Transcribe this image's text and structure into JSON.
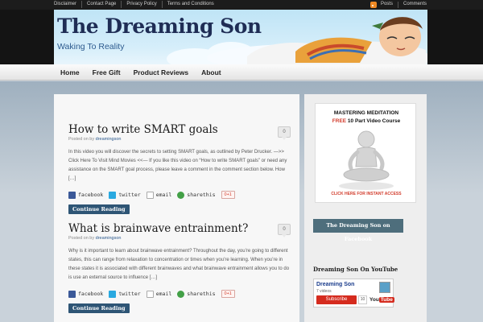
{
  "top_links": [
    "Disclaimer",
    "Contact Page",
    "Privacy Policy",
    "Terms and Conditions"
  ],
  "top_right": {
    "posts": "Posts",
    "comments": "Comments"
  },
  "site": {
    "title": "The Dreaming Son",
    "tagline": "Waking To Reality"
  },
  "nav": [
    "Home",
    "Free Gift",
    "Product Reviews",
    "About"
  ],
  "posts": [
    {
      "title": "How to write SMART goals",
      "posted_on_by": "Posted on by",
      "author": "dreamingson",
      "comments": "0",
      "excerpt": "In this video you will discover the secrets to setting SMART goals, as outlined by Peter Drucker. —>> Click Here To Visit Mind Movies <<— If you like this video on “How to write SMART goals” or need any assistance on the SMART goal process, please leave a comment in the comment section below. How […]",
      "continue": "Continue Reading"
    },
    {
      "title": "What is brainwave entrainment?",
      "posted_on_by": "Posted on by",
      "author": "dreamingson",
      "comments": "0",
      "excerpt": "Why is it important to learn about brainwave entrainment? Throughout the day, you’re going to different states, this can range from relaxation to concentration or times when you’re learning. When you’re in these states it is associated with different brainwaves and what brainwave entrainment allows you to do is use an external source to influence […]",
      "continue": "Continue Reading"
    }
  ],
  "share": {
    "facebook": "facebook",
    "twitter": "twitter",
    "email": "email",
    "sharethis": "sharethis",
    "gplus": "0+1"
  },
  "sidebar": {
    "ad": {
      "line1": "MASTERING MEDITATION",
      "free": "FREE",
      "line2_rest": " 10 Part Video Course",
      "cta": "CLICK HERE FOR INSTANT ACCESS"
    },
    "facebook_title": "The Dreaming Son on Facebook",
    "youtube_title": "Dreaming Son On YouTube",
    "youtube": {
      "channel": "Dreaming Son",
      "videos": "7 videos",
      "subscribe": "Subscribe",
      "subs_count": "10",
      "logo_you": "You",
      "logo_tube": "Tube"
    }
  },
  "colors": {
    "accent": "#2e5575",
    "topbar": "#1c1c1c",
    "banner_sky": "#bfe4f6",
    "title": "#1f2d55"
  }
}
